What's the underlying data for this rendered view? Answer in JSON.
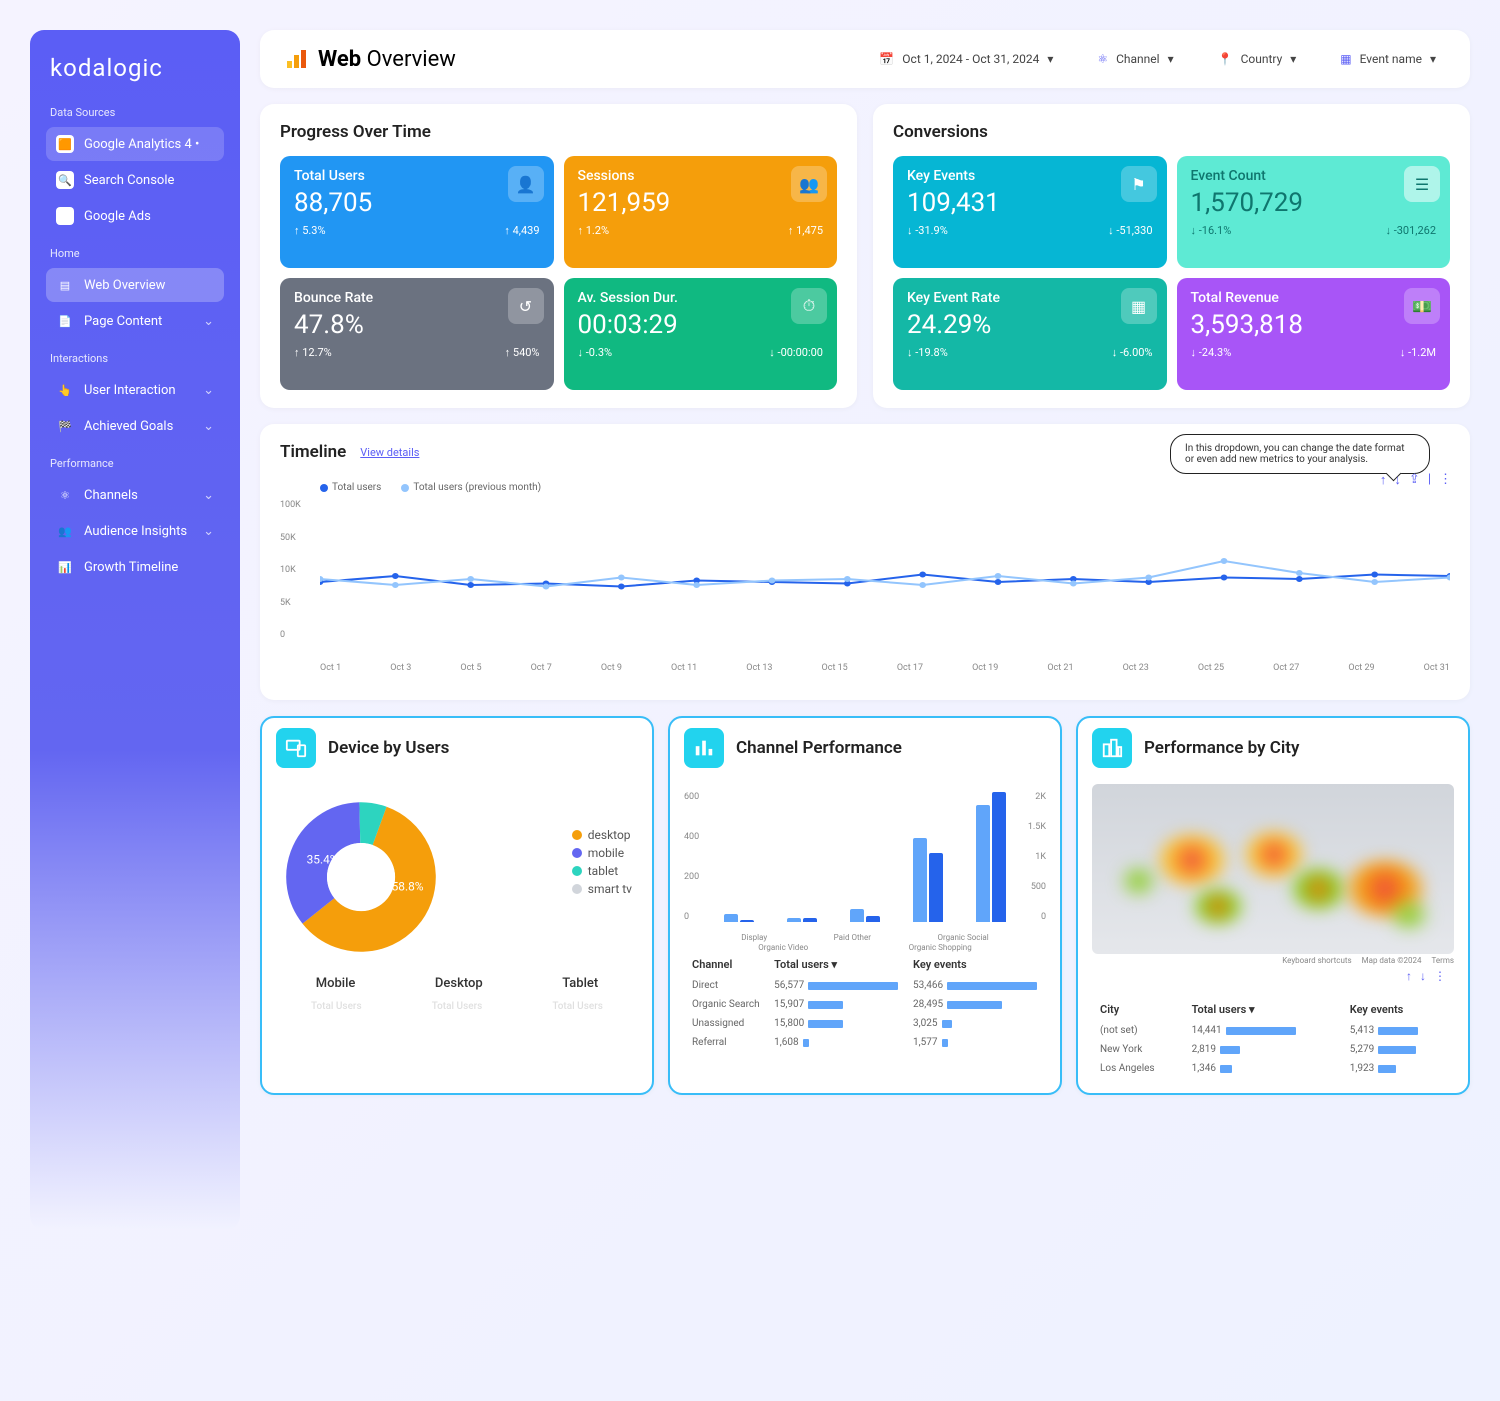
{
  "brand": "kodalogic",
  "sidebar": {
    "sections": [
      {
        "label": "Data Sources",
        "items": [
          {
            "label": "Google Analytics 4",
            "extra": "•",
            "active": true
          },
          {
            "label": "Search Console"
          },
          {
            "label": "Google Ads"
          }
        ]
      },
      {
        "label": "Home",
        "items": [
          {
            "label": "Web Overview",
            "highlight": true
          },
          {
            "label": "Page Content",
            "expandable": true
          }
        ]
      },
      {
        "label": "Interactions",
        "items": [
          {
            "label": "User Interaction",
            "expandable": true
          },
          {
            "label": "Achieved Goals",
            "expandable": true
          }
        ]
      },
      {
        "label": "Performance",
        "items": [
          {
            "label": "Channels",
            "expandable": true
          },
          {
            "label": "Audience Insights",
            "expandable": true
          },
          {
            "label": "Growth Timeline"
          }
        ]
      }
    ]
  },
  "header": {
    "title_strong": "Web",
    "title_rest": "Overview",
    "filters": {
      "date": "Oct 1, 2024 - Oct 31, 2024",
      "channel": "Channel",
      "country": "Country",
      "event": "Event name"
    }
  },
  "progress": {
    "title": "Progress Over Time",
    "cards": [
      {
        "color": "blue",
        "label": "Total Users",
        "value": "88,705",
        "delta": "5.3%",
        "dir": "up",
        "sub": "4,439",
        "subdir": "up"
      },
      {
        "color": "orange",
        "label": "Sessions",
        "value": "121,959",
        "delta": "1.2%",
        "dir": "up",
        "sub": "1,475",
        "subdir": "up"
      },
      {
        "color": "gray",
        "label": "Bounce Rate",
        "value": "47.8%",
        "delta": "12.7%",
        "dir": "up",
        "sub": "540%",
        "subdir": "up"
      },
      {
        "color": "green",
        "label": "Av. Session Dur.",
        "value": "00:03:29",
        "delta": "-0.3%",
        "dir": "down",
        "sub": "-00:00:00",
        "subdir": "down"
      }
    ]
  },
  "conversions": {
    "title": "Conversions",
    "cards": [
      {
        "color": "teal",
        "label": "Key Events",
        "value": "109,431",
        "delta": "-31.9%",
        "dir": "down",
        "sub": "-51,330",
        "subdir": "down"
      },
      {
        "color": "mint",
        "label": "Event Count",
        "value": "1,570,729",
        "delta": "-16.1%",
        "dir": "down",
        "sub": "-301,262",
        "subdir": "down"
      },
      {
        "color": "teal2",
        "label": "Key Event Rate",
        "value": "24.29%",
        "delta": "-19.8%",
        "dir": "down",
        "sub": "-6.00%",
        "subdir": "down"
      },
      {
        "color": "purple",
        "label": "Total Revenue",
        "value": "3,593,818",
        "delta": "-24.3%",
        "dir": "down",
        "sub": "-1.2M",
        "subdir": "down"
      }
    ]
  },
  "timeline": {
    "title": "Timeline",
    "view_details": "View details",
    "tooltip": "In this dropdown, you can change the date format or even add new metrics to your analysis.",
    "legend": [
      "Total users",
      "Total users (previous month)"
    ],
    "y_ticks": [
      "100K",
      "50K",
      "10K",
      "5K",
      "0"
    ]
  },
  "chart_data": {
    "type": "line",
    "title": "Timeline",
    "xlabel": "",
    "ylabel": "",
    "ylim": [
      0,
      100000
    ],
    "y_ticks": [
      0,
      5000,
      10000,
      50000,
      100000
    ],
    "categories": [
      "Oct 1",
      "Oct 3",
      "Oct 5",
      "Oct 7",
      "Oct 9",
      "Oct 11",
      "Oct 13",
      "Oct 15",
      "Oct 17",
      "Oct 19",
      "Oct 21",
      "Oct 23",
      "Oct 25",
      "Oct 27",
      "Oct 29",
      "Oct 31"
    ],
    "series": [
      {
        "name": "Total users",
        "color": "#2563eb",
        "values": [
          4800,
          5200,
          4600,
          4700,
          4500,
          4900,
          4800,
          4700,
          5300,
          4800,
          5000,
          4800,
          5100,
          5000,
          5300,
          5200
        ]
      },
      {
        "name": "Total users (previous month)",
        "color": "#93c5fd",
        "values": [
          5000,
          4600,
          5000,
          4500,
          5100,
          4600,
          4900,
          5000,
          4600,
          5200,
          4700,
          5100,
          6200,
          5400,
          4800,
          5100
        ]
      }
    ]
  },
  "device": {
    "title": "Device by Users",
    "legend": [
      {
        "label": "desktop",
        "color": "#f59e0b"
      },
      {
        "label": "mobile",
        "color": "#6366f1"
      },
      {
        "label": "tablet",
        "color": "#2dd4bf"
      },
      {
        "label": "smart tv",
        "color": "#d1d5db"
      }
    ],
    "slices": {
      "desktop": "58.8%",
      "mobile": "35.4%"
    },
    "headers": [
      "Mobile",
      "Desktop",
      "Tablet"
    ],
    "chart_data": {
      "type": "pie",
      "title": "Device by Users",
      "series": [
        {
          "name": "desktop",
          "value": 58.8,
          "color": "#f59e0b"
        },
        {
          "name": "mobile",
          "value": 35.4,
          "color": "#6366f1"
        },
        {
          "name": "tablet",
          "value": 5.5,
          "color": "#2dd4bf"
        },
        {
          "name": "smart tv",
          "value": 0.3,
          "color": "#d1d5db"
        }
      ]
    }
  },
  "channel": {
    "title": "Channel Performance",
    "chart_data": {
      "type": "bar",
      "categories": [
        "Display",
        "Organic Video",
        "Paid Other",
        "Organic Shopping",
        "Organic Social"
      ],
      "y_left_ticks": [
        "600",
        "400",
        "200",
        "0"
      ],
      "y_right_ticks": [
        "2K",
        "1.5K",
        "1K",
        "500",
        "0"
      ],
      "series": [
        {
          "name": "Total users",
          "color": "#60a5fa",
          "values": [
            40,
            20,
            60,
            400,
            560
          ]
        },
        {
          "name": "Key events",
          "color": "#2563eb",
          "values": [
            10,
            20,
            30,
            330,
            620
          ]
        }
      ]
    },
    "table": {
      "headers": [
        "Channel",
        "Total users ▾",
        "Key events"
      ],
      "rows": [
        {
          "c": "Direct",
          "u": "56,577",
          "ubar": 90,
          "k": "53,466",
          "kbar": 90
        },
        {
          "c": "Organic Search",
          "u": "15,907",
          "ubar": 35,
          "k": "28,495",
          "kbar": 55
        },
        {
          "c": "Unassigned",
          "u": "15,800",
          "ubar": 35,
          "k": "3,025",
          "kbar": 10
        },
        {
          "c": "Referral",
          "u": "1,608",
          "ubar": 6,
          "k": "1,577",
          "kbar": 6
        }
      ]
    }
  },
  "city": {
    "title": "Performance by City",
    "map_footer": [
      "Keyboard shortcuts",
      "Map data ©2024",
      "Terms"
    ],
    "table": {
      "headers": [
        "City",
        "Total users ▾",
        "Key events"
      ],
      "rows": [
        {
          "c": "(not set)",
          "u": "14,441",
          "ubar": 70,
          "k": "5,413",
          "kbar": 40
        },
        {
          "c": "New York",
          "u": "2,819",
          "ubar": 20,
          "k": "5,279",
          "kbar": 38
        },
        {
          "c": "Los Angeles",
          "u": "1,346",
          "ubar": 12,
          "k": "1,923",
          "kbar": 18
        }
      ]
    }
  }
}
